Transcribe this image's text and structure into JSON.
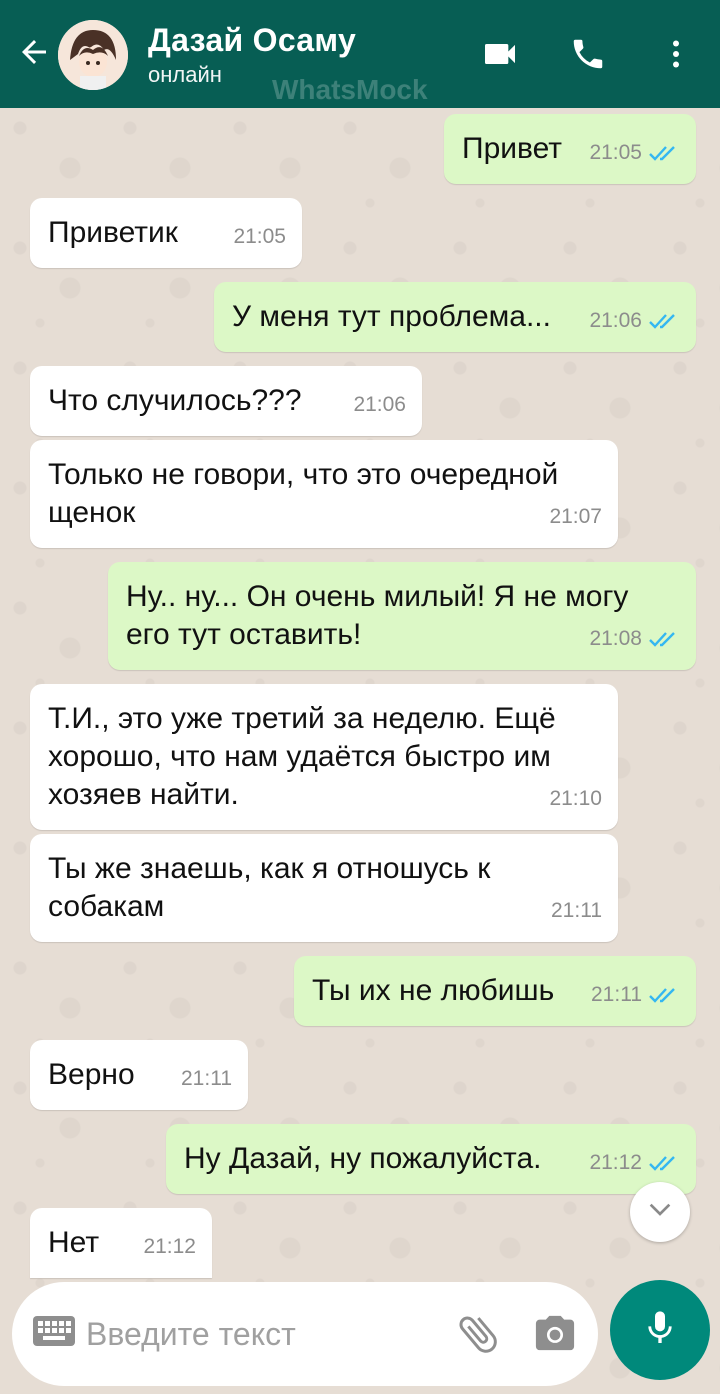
{
  "header": {
    "contact_name": "Дазай Осаму",
    "status": "онлайн",
    "watermark": "WhatsMock"
  },
  "messages": [
    {
      "dir": "out",
      "text": "Привет",
      "time": "21:05",
      "read": true
    },
    {
      "dir": "in",
      "text": "Приветик",
      "time": "21:05"
    },
    {
      "dir": "out",
      "text": "У меня тут проблема...",
      "time": "21:06",
      "read": true
    },
    {
      "dir": "in",
      "text": "Что случилось???",
      "time": "21:06"
    },
    {
      "dir": "in",
      "text": "Только не говори, что это очередной щенок",
      "time": "21:07"
    },
    {
      "dir": "out",
      "text": "Ну.. ну... Он очень милый! Я не могу его тут оставить!",
      "time": "21:08",
      "read": true
    },
    {
      "dir": "in",
      "text": "Т.И., это уже третий за неделю. Ещё хорошо, что нам удаётся быстро им хозяев найти.",
      "time": "21:10"
    },
    {
      "dir": "in",
      "text": "Ты же знаешь, как я отношусь к собакам",
      "time": "21:11"
    },
    {
      "dir": "out",
      "text": "Ты их не любишь",
      "time": "21:11",
      "read": true
    },
    {
      "dir": "in",
      "text": "Верно",
      "time": "21:11"
    },
    {
      "dir": "out",
      "text": "Ну Дазай, ну пожалуйста.",
      "time": "21:12",
      "read": true
    },
    {
      "dir": "in",
      "text": "Нет",
      "time": "21:12"
    }
  ],
  "composer": {
    "placeholder": "Введите текст"
  },
  "colors": {
    "header": "#075e54",
    "outgoing_bubble": "#dcf8c6",
    "incoming_bubble": "#ffffff",
    "read_ticks": "#34b7f1",
    "mic_button": "#00897b"
  },
  "icons": [
    "back-arrow-icon",
    "video-call-icon",
    "phone-icon",
    "more-vert-icon",
    "chevron-down-icon",
    "keyboard-icon",
    "paperclip-icon",
    "camera-icon",
    "mic-icon",
    "double-check-icon"
  ]
}
